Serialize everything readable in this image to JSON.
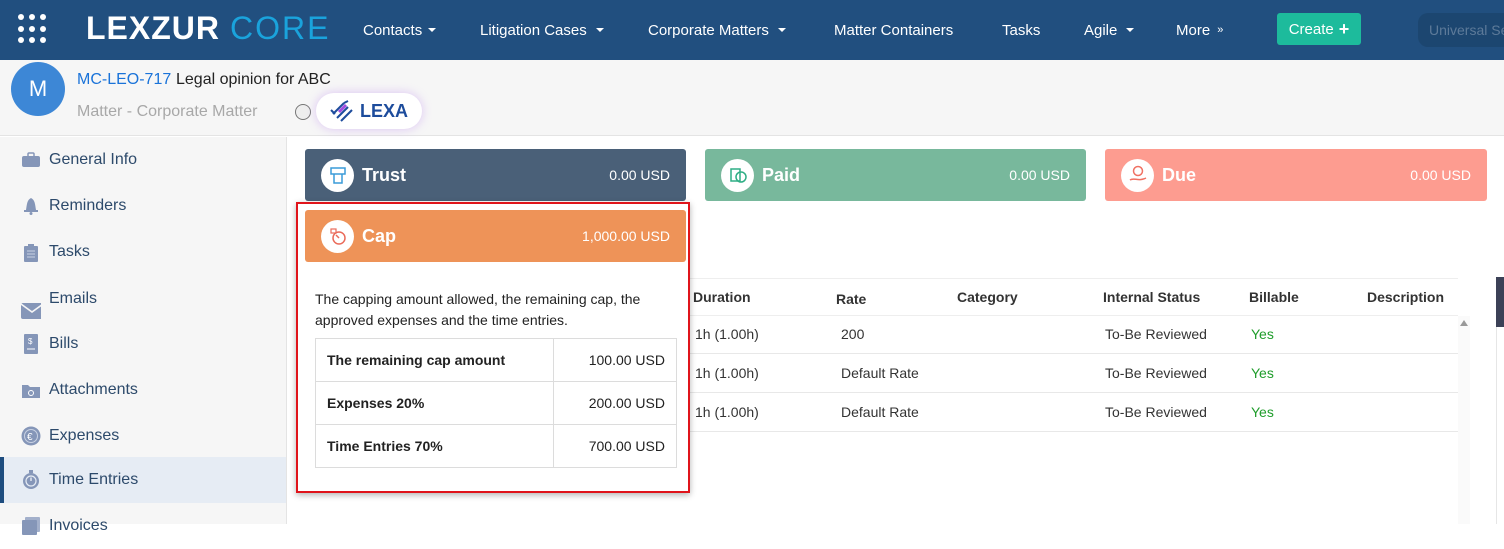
{
  "topbar": {
    "logo_main": "LEXZUR",
    "logo_sub": "CORE",
    "nav": [
      {
        "label": "Contacts",
        "dropdown": "caret"
      },
      {
        "label": "Litigation Cases",
        "dropdown": "caret"
      },
      {
        "label": "Corporate Matters",
        "dropdown": "caret"
      },
      {
        "label": "Matter Containers",
        "dropdown": null
      },
      {
        "label": "Tasks",
        "dropdown": null
      },
      {
        "label": "Agile",
        "dropdown": "caret"
      },
      {
        "label": "More",
        "dropdown": "double-chevron"
      }
    ],
    "create_label": "Create",
    "search_placeholder": "Universal Search"
  },
  "header": {
    "avatar_letter": "M",
    "matter_id": "MC-LEO-717",
    "matter_title": "Legal opinion for ABC",
    "matter_type": "Matter - Corporate Matter",
    "lexa_label": "LEXA"
  },
  "sidebar": {
    "items": [
      {
        "label": "General Info",
        "icon": "briefcase-icon"
      },
      {
        "label": "Reminders",
        "icon": "bell-icon"
      },
      {
        "label": "Tasks",
        "icon": "clipboard-icon"
      },
      {
        "label": "Emails",
        "icon": "envelope-icon"
      },
      {
        "label": "Bills",
        "icon": "receipt-icon"
      },
      {
        "label": "Attachments",
        "icon": "folder-icon"
      },
      {
        "label": "Expenses",
        "icon": "euro-icon"
      },
      {
        "label": "Time Entries",
        "icon": "stopwatch-icon",
        "active": true
      },
      {
        "label": "Invoices",
        "icon": "invoice-icon"
      }
    ]
  },
  "cards": {
    "trust": {
      "label": "Trust",
      "amount": "0.00 USD",
      "color": "#4a6078"
    },
    "paid": {
      "label": "Paid",
      "amount": "0.00 USD",
      "color": "#78b89c"
    },
    "due": {
      "label": "Due",
      "amount": "0.00 USD",
      "color": "#fd9c90"
    },
    "cap": {
      "label": "Cap",
      "amount": "1,000.00 USD",
      "color": "#ee9358"
    }
  },
  "cap_popup": {
    "description": "The capping amount allowed, the remaining cap, the approved expenses and the time entries.",
    "rows": [
      {
        "label": "The remaining cap amount",
        "value": "100.00 USD"
      },
      {
        "label": "Expenses 20%",
        "value": "200.00 USD"
      },
      {
        "label": "Time Entries 70%",
        "value": "700.00 USD"
      }
    ]
  },
  "time_table": {
    "columns": [
      "Duration",
      "Rate",
      "Category",
      "Internal Status",
      "Billable",
      "Description"
    ],
    "rows": [
      {
        "duration": "1h (1.00h)",
        "rate": "200",
        "category": "",
        "internal_status": "To-Be Reviewed",
        "billable": "Yes",
        "description": ""
      },
      {
        "duration": "1h (1.00h)",
        "rate": "Default Rate",
        "category": "",
        "internal_status": "To-Be Reviewed",
        "billable": "Yes",
        "description": ""
      },
      {
        "duration": "1h (1.00h)",
        "rate": "Default Rate",
        "category": "",
        "internal_status": "To-Be Reviewed",
        "billable": "Yes",
        "description": ""
      }
    ]
  }
}
